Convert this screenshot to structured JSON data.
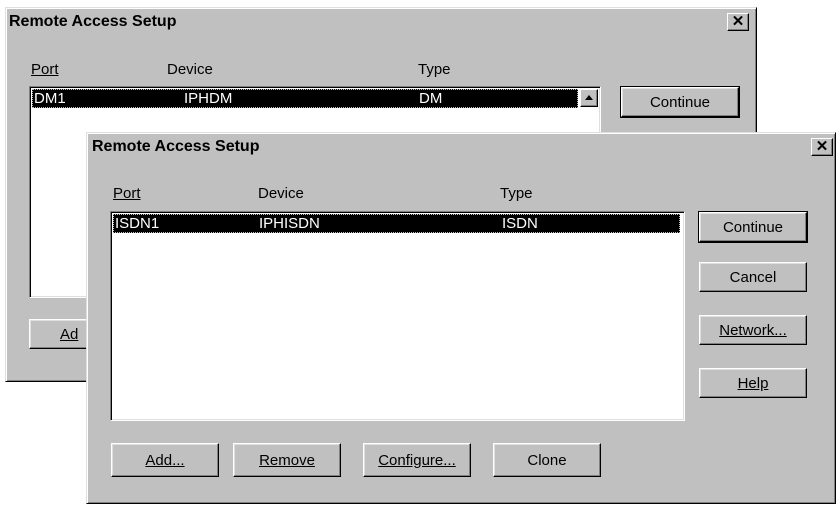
{
  "back_dialog": {
    "title": "Remote Access Setup",
    "close_glyph": "✕",
    "columns": {
      "port": "Port",
      "device": "Device",
      "type": "Type"
    },
    "row": {
      "port": "DM1",
      "device": "IPHDM",
      "type": "DM"
    },
    "continue_label": "Continue",
    "add_label_partial": "Ad"
  },
  "front_dialog": {
    "title": "Remote Access Setup",
    "close_glyph": "✕",
    "columns": {
      "port": "Port",
      "device": "Device",
      "type": "Type"
    },
    "row": {
      "port": "ISDN1",
      "device": "IPHISDN",
      "type": "ISDN"
    },
    "buttons": {
      "continue": "Continue",
      "cancel": "Cancel",
      "network": "Network...",
      "help": "Help",
      "add": "Add...",
      "remove": "Remove",
      "configure": "Configure...",
      "clone": "Clone"
    }
  }
}
